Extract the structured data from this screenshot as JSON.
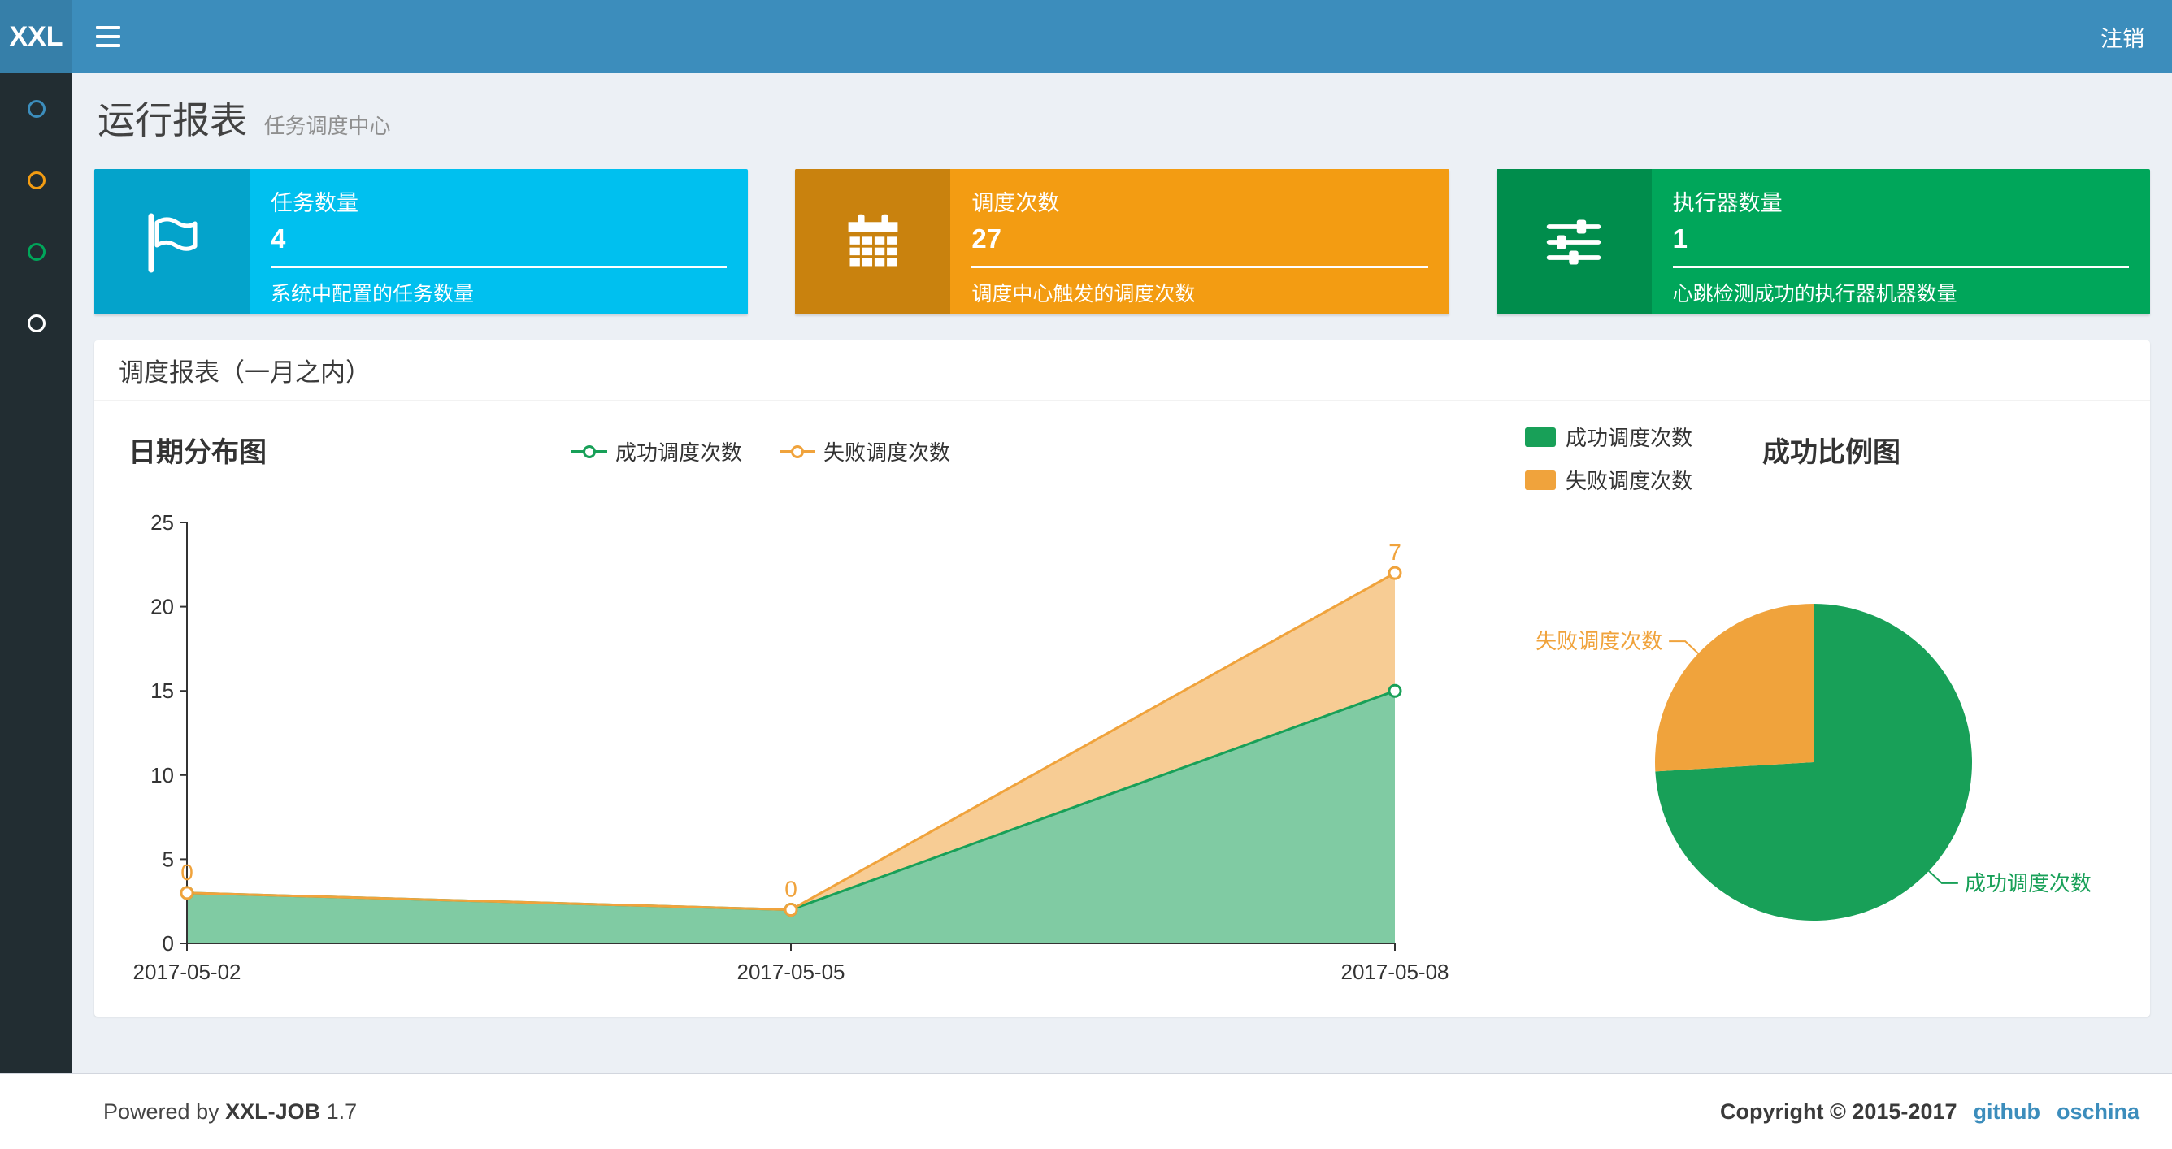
{
  "colors": {
    "navbar": "#3c8dbc",
    "logo_bg": "#367fa9",
    "sidebar_bg": "#222d32",
    "link": "#3c8dbc",
    "green": "#18a058",
    "orange": "#f0a33c"
  },
  "navbar": {
    "logo": "XXL",
    "logout": "注销"
  },
  "sidebar": {
    "items": [
      {
        "id": "menu-1",
        "icon": "circle-icon",
        "color": "#3c8dbc"
      },
      {
        "id": "menu-2",
        "icon": "circle-icon",
        "color": "#f39c12"
      },
      {
        "id": "menu-3",
        "icon": "circle-icon",
        "color": "#00a65a"
      },
      {
        "id": "menu-4",
        "icon": "circle-icon",
        "color": "#ffffff"
      }
    ]
  },
  "page": {
    "title": "运行报表",
    "subtitle": "任务调度中心"
  },
  "info_boxes": [
    {
      "title": "任务数量",
      "value": "4",
      "desc": "系统中配置的任务数量",
      "bg": "#00c0ef",
      "icon_bg": "#04a3cb",
      "icon": "flag-icon"
    },
    {
      "title": "调度次数",
      "value": "27",
      "desc": "调度中心触发的调度次数",
      "bg": "#f39c12",
      "icon_bg": "#c9820e",
      "icon": "calendar-icon"
    },
    {
      "title": "执行器数量",
      "value": "1",
      "desc": "心跳检测成功的执行器机器数量",
      "bg": "#00a65a",
      "icon_bg": "#008d4c",
      "icon": "sliders-icon"
    }
  ],
  "panel": {
    "title": "调度报表（一月之内）"
  },
  "footer": {
    "powered_by": "Powered by",
    "brand": "XXL-JOB",
    "version": "1.7",
    "copyright": "Copyright © 2015-2017",
    "links": [
      "github",
      "oschina"
    ]
  },
  "chart_data": [
    {
      "type": "area",
      "title": "日期分布图",
      "x": [
        "2017-05-02",
        "2017-05-05",
        "2017-05-08"
      ],
      "stacked": true,
      "grid": false,
      "legend_position": "top-center",
      "ylim": [
        0,
        25
      ],
      "y_ticks": [
        0,
        5,
        10,
        15,
        20,
        25
      ],
      "series": [
        {
          "name": "成功调度次数",
          "values": [
            3,
            2,
            15
          ],
          "color": "#18a058",
          "fill": "rgba(24,160,88,0.55)"
        },
        {
          "name": "失败调度次数",
          "values": [
            0,
            0,
            7
          ],
          "color": "#f0a33c",
          "fill": "rgba(240,163,60,0.55)",
          "point_labels": [
            0,
            0,
            7
          ]
        }
      ]
    },
    {
      "type": "pie",
      "title": "成功比例图",
      "legend_position": "top-left",
      "start_angle": 90,
      "clockwise": true,
      "slices": [
        {
          "name": "成功调度次数",
          "value": 20,
          "color": "#18a058"
        },
        {
          "name": "失败调度次数",
          "value": 7,
          "color": "#f0a33c"
        }
      ]
    }
  ]
}
